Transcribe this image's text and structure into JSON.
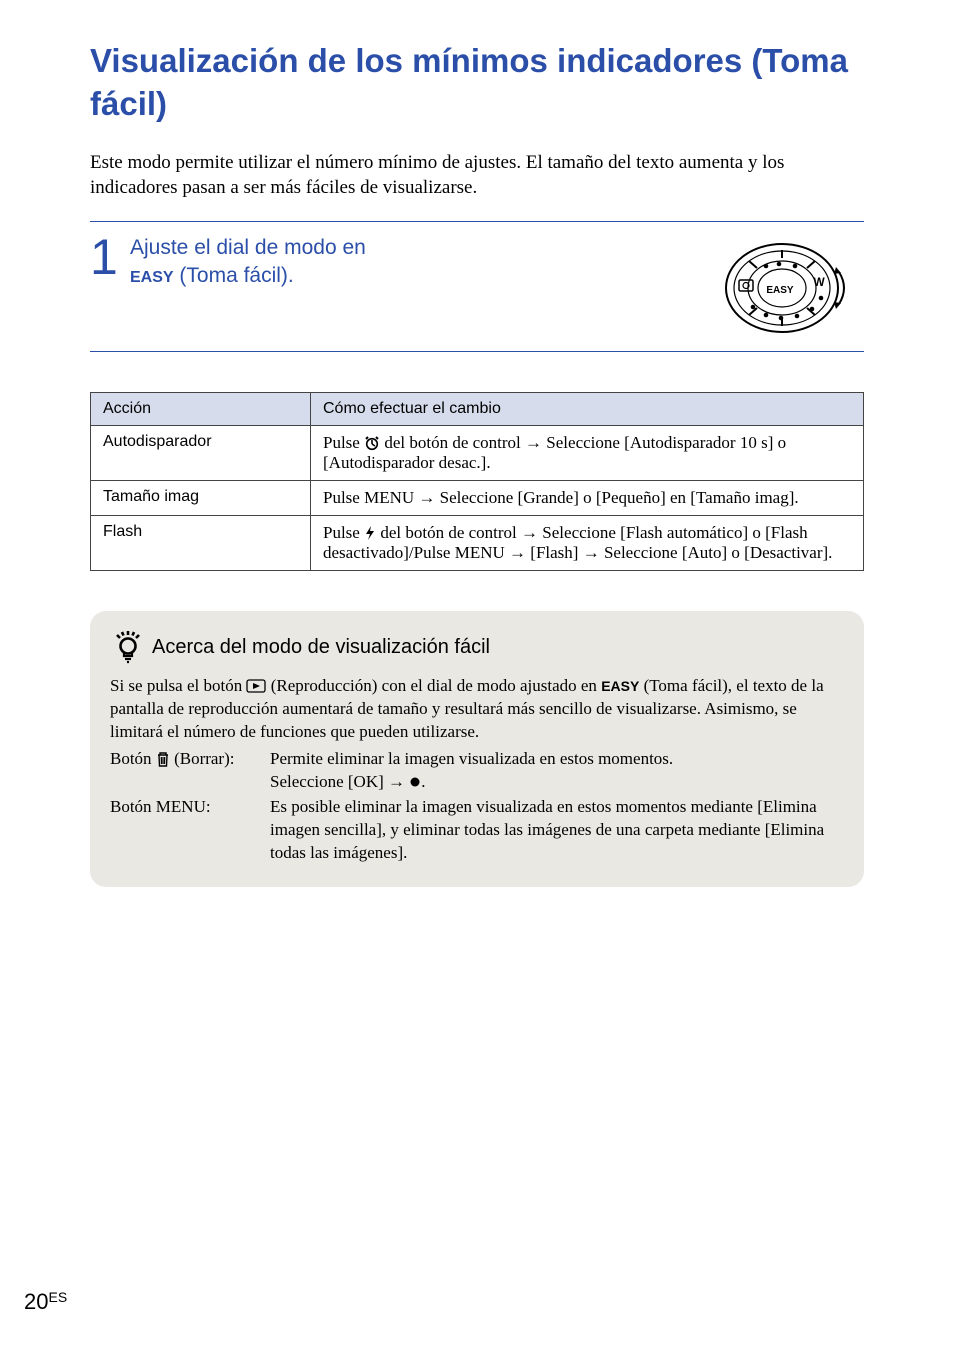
{
  "title": "Visualización de los mínimos indicadores (Toma fácil)",
  "intro": "Este modo permite utilizar el número mínimo de ajustes. El tamaño del texto aumenta y los indicadores pasan a ser más fáciles de visualizarse.",
  "step": {
    "number": "1",
    "line1": "Ajuste el dial de modo en ",
    "easy_label": "EASY",
    "line2": " (Toma fácil).",
    "dial_easy": "EASY",
    "dial_w": "W"
  },
  "table": {
    "headers": {
      "col1": "Acción",
      "col2": "Cómo efectuar el cambio"
    },
    "rows": [
      {
        "action": "Autodisparador",
        "pre": "Pulse ",
        "icon": "self-timer",
        "mid": " del botón de control ",
        "arrow": "→",
        "post": " Seleccione [Autodisparador 10 s] o [Autodisparador desac.]."
      },
      {
        "action": "Tamaño imag",
        "pre": "Pulse MENU ",
        "arrow": "→",
        "post": " Seleccione [Grande] o [Pequeño] en [Tamaño imag]."
      },
      {
        "action": "Flash",
        "pre": "Pulse ",
        "icon": "flash",
        "mid": " del botón de control ",
        "arrow1": "→",
        "post1": " Seleccione [Flash automático] o [Flash desactivado]/Pulse MENU ",
        "arrow2": "→",
        "mid2": " [Flash] ",
        "arrow3": "→",
        "post2": " Seleccione [Auto] o [Desactivar]."
      }
    ]
  },
  "tip": {
    "heading": "Acerca del modo de visualización fácil",
    "para_pre": "Si se pulsa el botón ",
    "para_mid": " (Reproducción) con el dial de modo ajustado en ",
    "easy_label": "EASY",
    "para_post": " (Toma fácil), el texto de la pantalla de reproducción aumentará de tamaño y resultará más sencillo de visualizarse. Asimismo, se limitará el número de funciones que pueden utilizarse.",
    "defs": [
      {
        "label_pre": "Botón ",
        "label_icon": "trash",
        "label_post": " (Borrar):",
        "value_line1": "Permite eliminar la imagen visualizada en estos momentos.",
        "value_line2_pre": "Seleccione [OK] ",
        "value_line2_arrow": "→",
        "value_line2_icon": "dot",
        "value_line2_post": "."
      },
      {
        "label": "Botón MENU:",
        "value": "Es posible eliminar la imagen visualizada en estos momentos mediante [Elimina imagen sencilla], y eliminar todas las imágenes de una carpeta mediante [Elimina todas las imágenes]."
      }
    ]
  },
  "page": {
    "number": "20",
    "suffix": "ES"
  }
}
